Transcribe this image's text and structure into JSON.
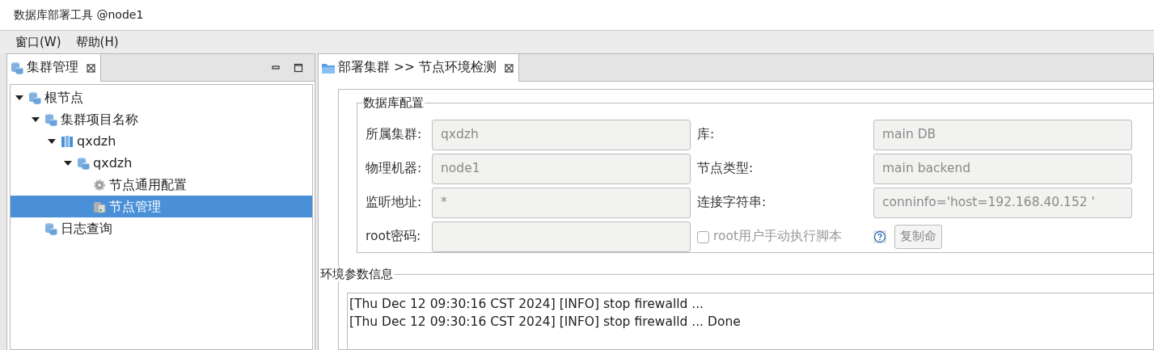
{
  "window": {
    "title": "数据库部署工具 @node1"
  },
  "menu": [
    {
      "label": "窗口(W)"
    },
    {
      "label": "帮助(H)"
    }
  ],
  "left_panel": {
    "tab": {
      "label": "集群管理",
      "selected": true
    },
    "tree": [
      {
        "label": "根节点",
        "kind": "database",
        "expanded": true,
        "selected": false,
        "children": [
          {
            "label": "集群项目名称",
            "kind": "database",
            "expanded": true,
            "selected": false,
            "children": [
              {
                "label": "qxdzh",
                "kind": "cluster",
                "expanded": true,
                "selected": false,
                "children": [
                  {
                    "label": "qxdzh",
                    "kind": "database",
                    "expanded": true,
                    "selected": false,
                    "children": [
                      {
                        "label": "节点通用配置",
                        "kind": "gear",
                        "selected": false
                      },
                      {
                        "label": "节点管理",
                        "kind": "server",
                        "selected": true
                      }
                    ]
                  }
                ]
              }
            ]
          },
          {
            "label": "日志查询",
            "kind": "database",
            "selected": false
          }
        ]
      }
    ]
  },
  "right_panel": {
    "tab": {
      "label": "部署集群 >> 节点环境检测",
      "selected": true
    },
    "db_config": {
      "title": "数据库配置",
      "rows": [
        {
          "left": {
            "label": "所属集群:",
            "value": "qxdzh"
          },
          "right": {
            "label": "库:",
            "value": "main DB"
          }
        },
        {
          "left": {
            "label": "物理机器:",
            "value": "node1"
          },
          "right": {
            "label": "节点类型:",
            "value": "main backend"
          }
        },
        {
          "left": {
            "label": "监听地址:",
            "value": "*"
          },
          "right": {
            "label": "连接字符串:",
            "value": "conninfo='host=192.168.40.152 '"
          }
        }
      ],
      "password": {
        "label": "root密码:"
      },
      "manual_run": {
        "label": "root用户手动执行脚本",
        "checked": false,
        "disabled": true
      },
      "copy_button": {
        "label": "复制命"
      }
    },
    "env_info": {
      "title": "环境参数信息",
      "log": [
        "[Thu Dec 12 09:30:16 CST 2024] [INFO] stop firewalld ...",
        "[Thu Dec 12 09:30:16 CST 2024] [INFO] stop firewalld ... Done"
      ]
    }
  }
}
